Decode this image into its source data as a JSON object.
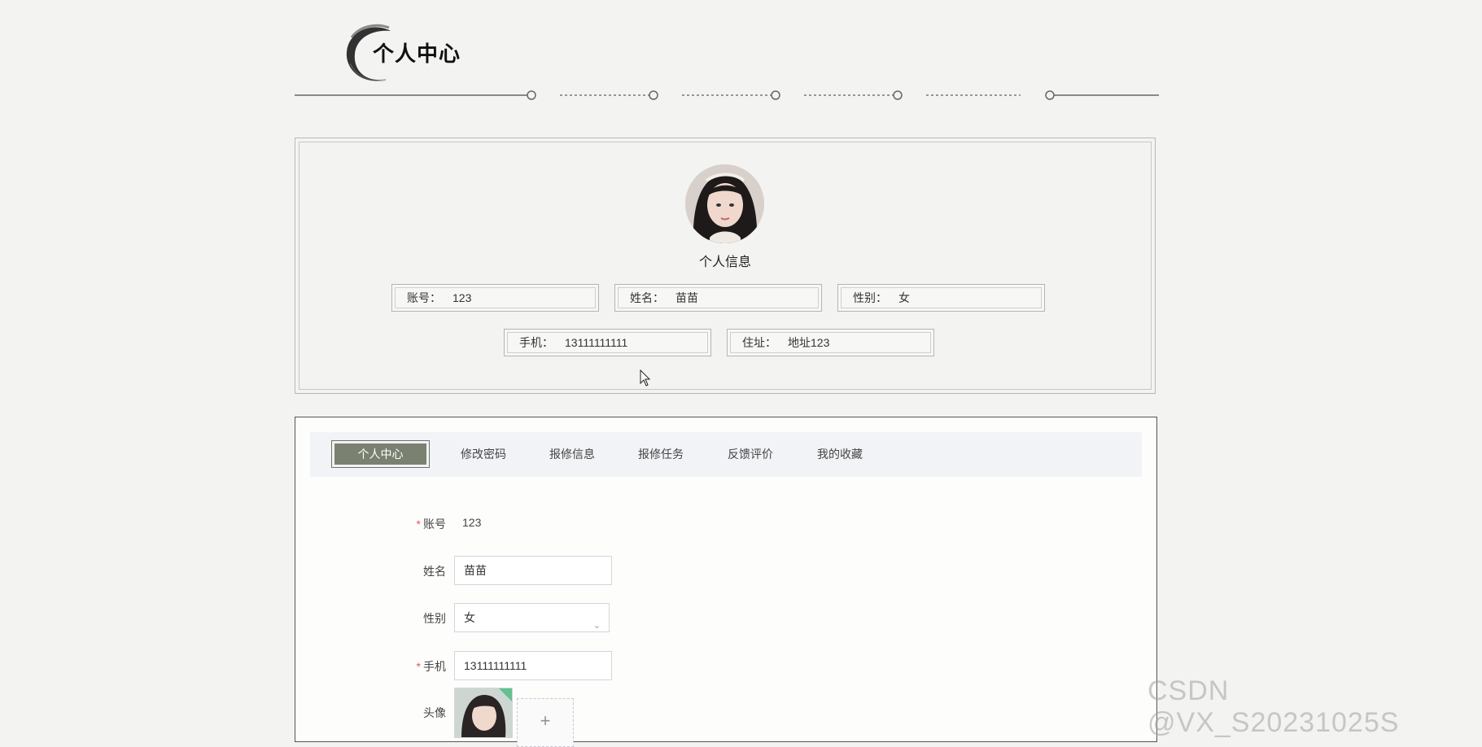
{
  "header": {
    "title": "个人中心"
  },
  "profile": {
    "caption": "个人信息",
    "fields": [
      {
        "label": "账号：",
        "value": "123"
      },
      {
        "label": "姓名：",
        "value": "苗苗"
      },
      {
        "label": "性别：",
        "value": "女"
      },
      {
        "label": "手机：",
        "value": "13111111111"
      },
      {
        "label": "住址：",
        "value": "地址123"
      }
    ]
  },
  "tabs": [
    {
      "label": "个人中心",
      "active": true
    },
    {
      "label": "修改密码"
    },
    {
      "label": "报修信息"
    },
    {
      "label": "报修任务"
    },
    {
      "label": "反馈评价"
    },
    {
      "label": "我的收藏"
    }
  ],
  "form": {
    "account": {
      "label": "账号",
      "value": "123",
      "required": "*"
    },
    "name": {
      "label": "姓名",
      "value": "苗苗"
    },
    "gender": {
      "label": "性别",
      "value": "女"
    },
    "phone": {
      "label": "手机",
      "value": "13111111111",
      "required": "*"
    },
    "avatar": {
      "label": "头像",
      "upload_symbol": "+"
    }
  },
  "watermark": "CSDN @VX_S20231025S",
  "colors": {
    "accent": "#7a8170",
    "required": "#e15b5b",
    "background": "#f3f3f1"
  }
}
